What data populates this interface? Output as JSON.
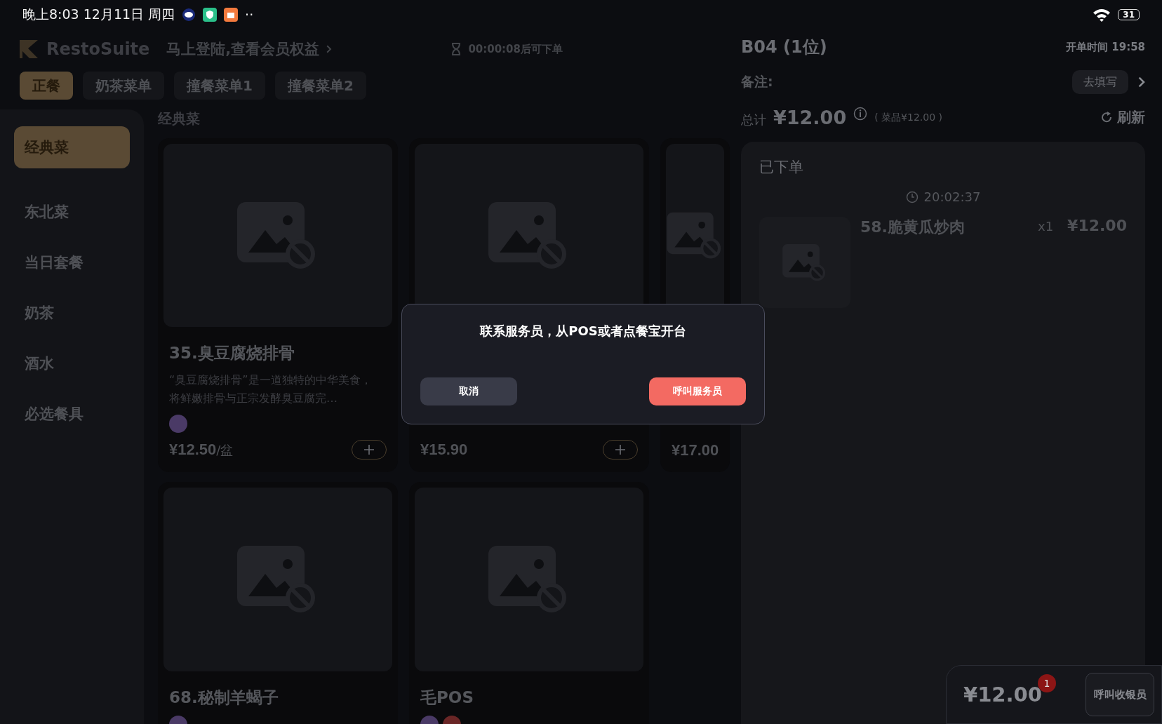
{
  "status_bar": {
    "time": "晚上8:03 12月11日 周四",
    "more": "··",
    "battery": "31"
  },
  "header": {
    "brand": "RestoSuite",
    "login_prompt": "马上登陆,查看会员权益",
    "countdown": "00:00:08后可下单"
  },
  "menu_tabs": [
    {
      "label": "正餐",
      "selected": true
    },
    {
      "label": "奶茶菜单",
      "selected": false
    },
    {
      "label": "撞餐菜单1",
      "selected": false
    },
    {
      "label": "撞餐菜单2",
      "selected": false
    }
  ],
  "categories": [
    {
      "label": "经典菜",
      "selected": true
    },
    {
      "label": "东北菜",
      "selected": false
    },
    {
      "label": "当日套餐",
      "selected": false
    },
    {
      "label": "奶茶",
      "selected": false
    },
    {
      "label": "酒水",
      "selected": false
    },
    {
      "label": "必选餐具",
      "selected": false
    }
  ],
  "section_title": "经典菜",
  "dishes": [
    {
      "name": "35.臭豆腐烧排骨",
      "description": "“臭豆腐烧排骨”是一道独特的中华美食，将鲜嫩排骨与正宗发酵臭豆腐完…",
      "tags": [
        {
          "color": "#4a3a66"
        }
      ],
      "price": "¥12.50",
      "unit": "/盆"
    },
    {
      "price": "¥15.90"
    },
    {
      "price": "¥17.00"
    },
    {
      "name": "68.秘制羊蝎子",
      "tags": [
        {
          "color": "#4a3a66"
        }
      ]
    },
    {
      "name": "毛POS",
      "tags": [
        {
          "color": "#4a3a66"
        },
        {
          "color": "#6a2626"
        }
      ]
    }
  ],
  "order": {
    "table": "B04 (1位)",
    "open_time": "开单时间 19:58",
    "note_label": "备注:",
    "note_button": "去填写",
    "total_label": "总计",
    "total": "¥12.00",
    "total_detail": "( 菜品¥12.00 )",
    "refresh": "刷新",
    "placed_title": "已下单",
    "placed_time": "20:02:37",
    "items": [
      {
        "name": "58.脆黄瓜炒肉",
        "qty": "x1",
        "price": "¥12.00"
      }
    ]
  },
  "cart": {
    "total": "¥12.00",
    "count": "1",
    "call_cashier": "呼叫收银员"
  },
  "dialog": {
    "message": "联系服务员，从POS或者点餐宝开台",
    "cancel": "取消",
    "confirm": "呼叫服务员"
  }
}
